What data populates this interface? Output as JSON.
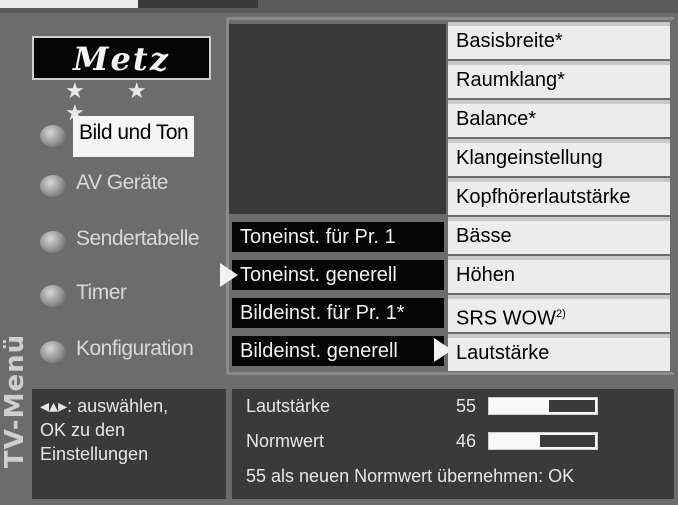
{
  "brand": {
    "logo_text": "Metz",
    "stars": "★ ★ ★"
  },
  "side_label": "TV-Menü",
  "main_menu": [
    {
      "label": "Bild und Ton",
      "active": true
    },
    {
      "label": "AV Geräte",
      "active": false
    },
    {
      "label": "Sendertabelle",
      "active": false
    },
    {
      "label": "Timer",
      "active": false
    },
    {
      "label": "Konfiguration",
      "active": false
    }
  ],
  "sub_menu": [
    {
      "label": "Toneinst. für Pr. 1",
      "selected": false
    },
    {
      "label": "Toneinst. generell",
      "selected": true
    },
    {
      "label": "Bildeinst. für Pr. 1*",
      "selected": false
    },
    {
      "label": "Bildeinst. generell",
      "selected": false
    }
  ],
  "options": [
    {
      "label": "Basisbreite*"
    },
    {
      "label": "Raumklang*"
    },
    {
      "label": "Balance*"
    },
    {
      "label": "Klangeinstellung"
    },
    {
      "label": "Kopfhörerlautstärke"
    },
    {
      "label": "Bässe"
    },
    {
      "label": "Höhen"
    },
    {
      "label": "SRS WOW"
    },
    {
      "label": "Lautstärke",
      "selected": true
    }
  ],
  "srs_superscript": "2)",
  "help": {
    "line1": "◂▴▸: auswählen,",
    "line2": "OK zu den",
    "line3": "Einstellungen"
  },
  "status": {
    "volume_label": "Lautstärke",
    "volume_value": "55",
    "volume_level": 0.55,
    "norm_label": "Normwert",
    "norm_value": "46",
    "norm_level": 0.46,
    "prompt": "55 als neuen Normwert übernehmen: OK"
  },
  "colors": {
    "background": "#6c6c6c",
    "panel_dark": "#3a3a3a",
    "highlight": "#f5f5f5"
  }
}
